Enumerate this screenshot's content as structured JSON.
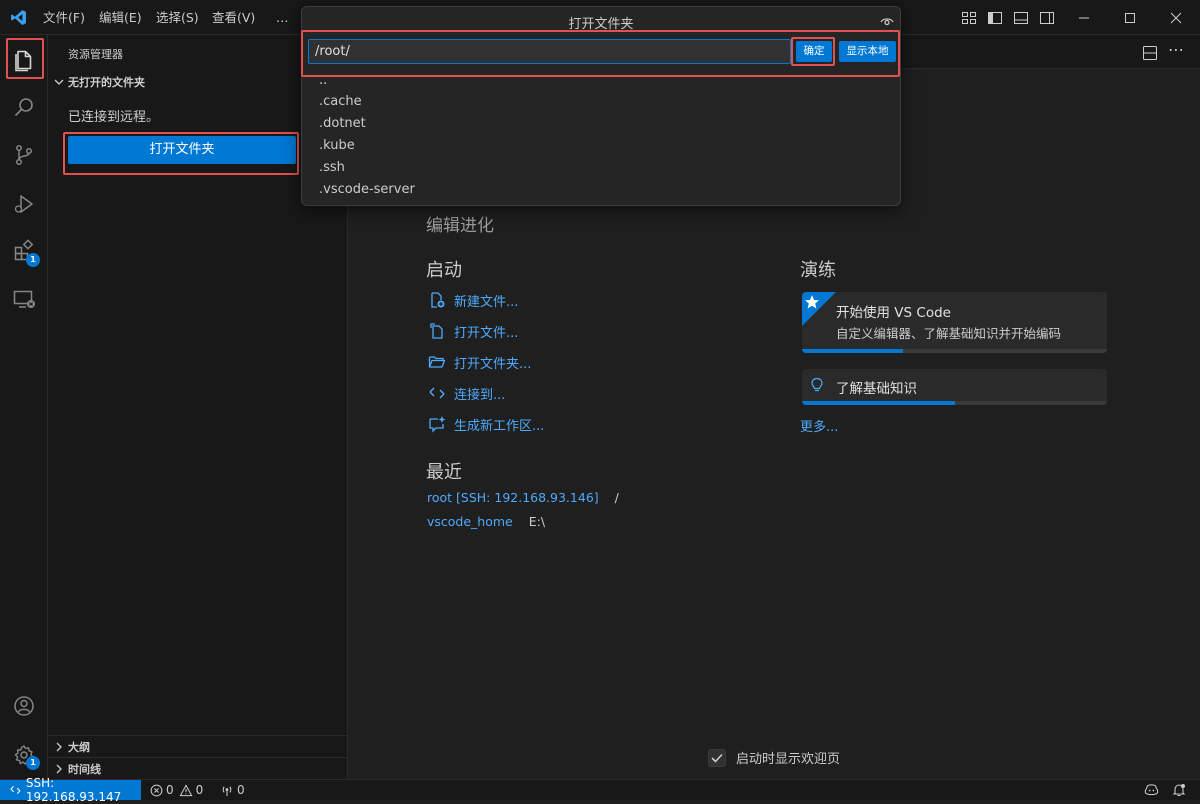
{
  "titlebar": {
    "menus": [
      "文件(F)",
      "编辑(E)",
      "选择(S)",
      "查看(V)",
      "…"
    ]
  },
  "sidebar": {
    "title": "资源管理器",
    "section": "无打开的文件夹",
    "connected_msg": "已连接到远程。",
    "open_folder_button": "打开文件夹",
    "bottom_sections": [
      "大纲",
      "时间线"
    ]
  },
  "activity": {
    "extensions_badge": "1",
    "settings_badge": "1"
  },
  "welcome": {
    "subtitle": "编辑进化",
    "start": {
      "title": "启动",
      "items": [
        "新建文件...",
        "打开文件...",
        "打开文件夹...",
        "连接到...",
        "生成新工作区..."
      ]
    },
    "recent": {
      "title": "最近",
      "items": [
        {
          "name": "root [SSH: 192.168.93.146]",
          "path": "/"
        },
        {
          "name": "vscode_home",
          "path": "E:\\"
        }
      ]
    },
    "walkthroughs": {
      "title": "演练",
      "card1_title": "开始使用 VS Code",
      "card1_desc": "自定义编辑器、了解基础知识并开始编码",
      "card1_progress": 0.33,
      "card2_title": "了解基础知识",
      "card2_progress": 0.5,
      "more": "更多..."
    },
    "show_on_startup": "启动时显示欢迎页"
  },
  "dialog": {
    "title": "打开文件夹",
    "input_value": "/root/",
    "ok_button": "确定",
    "show_local_button": "显示本地",
    "items": [
      "..",
      ".cache",
      ".dotnet",
      ".kube",
      ".ssh",
      ".vscode-server"
    ]
  },
  "statusbar": {
    "remote": "SSH: 192.168.93.147",
    "errors": "0",
    "warnings": "0",
    "ports": "0"
  },
  "colors": {
    "accent": "#0078d4",
    "link": "#4daafc",
    "highlight": "#e05252"
  }
}
